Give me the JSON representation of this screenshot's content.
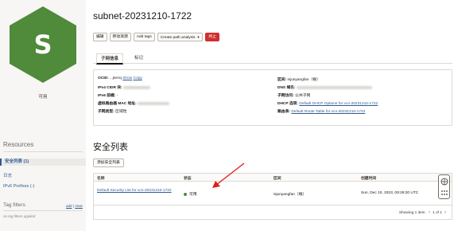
{
  "sidebar": {
    "avatar_letter": "S",
    "status": "可用",
    "resources_title": "Resources",
    "items": [
      {
        "label": "安全列表 (1)",
        "active": true
      },
      {
        "label": "日志",
        "active": false
      },
      {
        "label": "IPv6 Prefixes (-)",
        "active": false
      }
    ],
    "tag_filters_title": "Tag filters",
    "tag_add": "add",
    "tag_clear": "clear",
    "tag_empty": "no tag filters applied"
  },
  "header": {
    "title": "subnet-20231210-1722"
  },
  "toolbar": {
    "edit": "编辑",
    "move": "移动资源",
    "add_tags": "Add tags",
    "path_analysis": "Create path analysis",
    "terminate": "终止"
  },
  "tabs": {
    "info": "子网信息",
    "tags": "标记"
  },
  "info": {
    "ocid_label": "OCID:",
    "ocid_value": "...jterrq",
    "show": "Show",
    "copy": "Copy",
    "ipv4_label": "IPv4 CIDR 块:",
    "ipv6_label": "IPv6 前缀:",
    "ipv6_value": "-",
    "mac_label": "虚拟路由器 MAC 地址:",
    "type_label": "子网类型:",
    "type_value": "区域性",
    "compartment_label": "区间:",
    "compartment_value": "isjunyangfan（根）",
    "dns_label": "DNS 域名:",
    "access_label": "子网访问:",
    "access_value": "公共子网",
    "dhcp_label": "DHCP 选项:",
    "dhcp_value": "Default DHCP Options for vcn-20231210-1722",
    "route_label": "路由表:",
    "route_value": "Default Route Table for vcn-20231210-1722"
  },
  "security": {
    "section_title": "安全列表",
    "create_button": "添加安全列表",
    "columns": [
      "名称",
      "状态",
      "区间",
      "创建时间"
    ],
    "rows": [
      {
        "name": "Default Security List for vcn-20231210-1722",
        "status": "可用",
        "compartment": "isjunyangfan（根）",
        "created": "Sun, Dec 10, 2023, 09:26:20 UTC"
      }
    ],
    "pager_text": "Showing 1 item",
    "pager_pages": "1 of 1"
  },
  "colors": {
    "hex_fill": "#4f8b3a",
    "link": "#2d5c93",
    "danger": "#d0302f",
    "annotation_arrow": "#e0201c"
  }
}
